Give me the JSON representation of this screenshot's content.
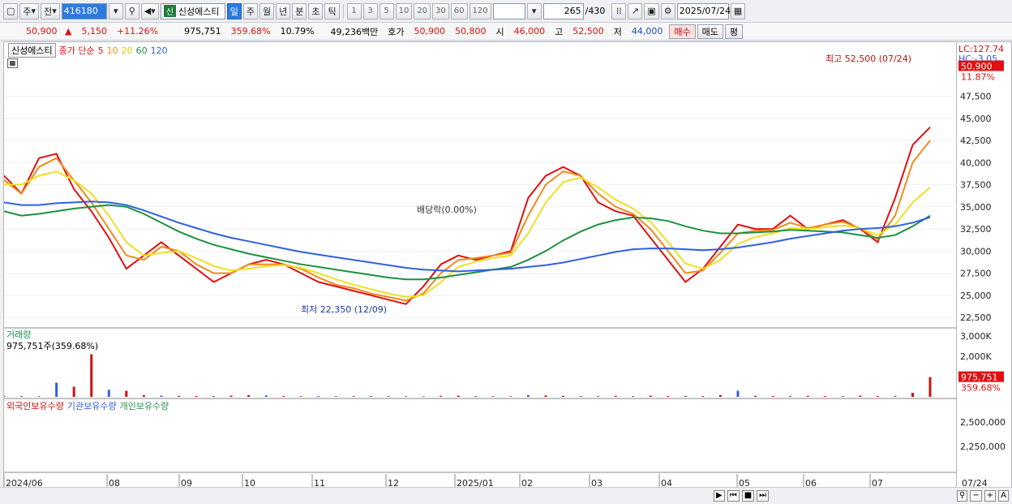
{
  "toolbar": {
    "type_selected": "주",
    "prev_label": "전",
    "code": "416180",
    "stock_name": "신성에스티",
    "shin_label": "신",
    "period_buttons": [
      "일",
      "주",
      "월",
      "년",
      "분",
      "초",
      "틱"
    ],
    "period_active": "일",
    "interval_buttons": [
      "1",
      "3",
      "5",
      "10",
      "20",
      "30",
      "60",
      "120"
    ],
    "count": "265",
    "count_total": "/430",
    "date": "2025/07/24"
  },
  "quote": {
    "price": "50,900",
    "change": "5,150",
    "change_pct": "+11.26%",
    "volume": "975,751",
    "vol_ratio": "359.68%",
    "turnover_pct": "10.79%",
    "amount": "49,236백만",
    "ask_label": "호가",
    "ask1": "50,900",
    "ask2": "50,800",
    "open_label": "시",
    "open": "46,000",
    "high_label": "고",
    "high": "52,500",
    "low_label": "저",
    "low": "44,000",
    "buy_btn": "매수",
    "sell_btn": "매도",
    "eval_btn": "평"
  },
  "price_panel": {
    "legend_name": "신성에스티",
    "legend_series": "종가 단순",
    "ma": [
      {
        "label": "5",
        "color": "#e01010"
      },
      {
        "label": "10",
        "color": "#f08a1c"
      },
      {
        "label": "20",
        "color": "#f0e020"
      },
      {
        "label": "60",
        "color": "#1e9040"
      },
      {
        "label": "120",
        "color": "#3060e0"
      }
    ],
    "lc": "LC:127.74",
    "hc": "HC:-3.05",
    "cur_price_tag": "50,900",
    "cur_pct_tag": "11.87%",
    "y_ticks": [
      "47,500",
      "45,000",
      "42,500",
      "40,000",
      "37,500",
      "35,000",
      "32,500",
      "30,000",
      "27,500",
      "25,000",
      "22,500"
    ],
    "ann_high": "최고 52,500 (07/24)",
    "ann_low": "최저 22,350 (12/09)",
    "ann_div": "배당락(0.00%)"
  },
  "volume_panel": {
    "title": "거래량",
    "sub": "975,751주(359.68%)",
    "y_ticks": [
      "3,000K",
      "2,000K",
      "1,000K"
    ],
    "tag_value": "975,751",
    "tag_pct": "359.68%"
  },
  "holdings_panel": {
    "series": [
      {
        "label": "외국인보유수량",
        "color": "#d01010"
      },
      {
        "label": "기관보유수량",
        "color": "#3060e0"
      },
      {
        "label": "개인보유수량",
        "color": "#2a9050"
      }
    ],
    "y_ticks": [
      "2,500,000",
      "2,250,000"
    ]
  },
  "x_axis": {
    "labels": [
      "2024/06",
      "08",
      "09",
      "10",
      "11",
      "12",
      "2025/01",
      "02",
      "03",
      "04",
      "05",
      "06",
      "07"
    ],
    "last_label": "07/24"
  },
  "chart_data": {
    "type": "line",
    "title": "",
    "ylim": [
      21500,
      52500
    ],
    "ma_series": [
      {
        "name": "5",
        "values": [
          38500,
          36500,
          40500,
          41000,
          37000,
          34500,
          31500,
          28000,
          29500,
          31000,
          29500,
          28000,
          26500,
          27500,
          28500,
          29000,
          28500,
          27500,
          26500,
          26000,
          25500,
          25000,
          24500,
          24000,
          26000,
          28500,
          29500,
          29000,
          29500,
          30000,
          36000,
          38500,
          39500,
          38500,
          35500,
          34500,
          34000,
          31500,
          29000,
          26500,
          28000,
          30500,
          33000,
          32500,
          32500,
          34000,
          32500,
          33000,
          33500,
          32500,
          31000,
          36000,
          42000,
          44000
        ]
      },
      {
        "name": "10",
        "values": [
          38000,
          36500,
          39500,
          40500,
          38000,
          35500,
          32500,
          29500,
          29000,
          30500,
          30000,
          28500,
          27500,
          27500,
          28500,
          28500,
          28500,
          28000,
          27000,
          26200,
          25800,
          25200,
          24800,
          24400,
          25200,
          27500,
          29000,
          29200,
          29500,
          29800,
          34000,
          37500,
          39000,
          38500,
          36500,
          35000,
          34200,
          32500,
          30000,
          27500,
          27800,
          29800,
          32000,
          32300,
          32400,
          33200,
          32600,
          33000,
          33300,
          32600,
          31300,
          34000,
          40000,
          42500
        ]
      },
      {
        "name": "20",
        "values": [
          37500,
          37500,
          38500,
          39000,
          38000,
          36500,
          34000,
          31000,
          29500,
          29800,
          30000,
          29200,
          28300,
          27800,
          28000,
          28300,
          28400,
          28100,
          27500,
          26800,
          26200,
          25700,
          25200,
          24800,
          25000,
          26500,
          28200,
          28800,
          29200,
          29500,
          32000,
          35500,
          37800,
          38300,
          37200,
          35800,
          34800,
          33300,
          31000,
          28600,
          28000,
          29000,
          30800,
          31600,
          32000,
          32600,
          32500,
          32700,
          32900,
          32600,
          31800,
          33000,
          35500,
          37200
        ]
      },
      {
        "name": "60",
        "values": [
          34500,
          34000,
          34200,
          34500,
          34800,
          35000,
          35200,
          35000,
          34200,
          33200,
          32200,
          31400,
          30700,
          30200,
          29700,
          29300,
          28900,
          28500,
          28200,
          27900,
          27600,
          27300,
          27000,
          26800,
          26800,
          27000,
          27300,
          27600,
          27900,
          28200,
          29000,
          30000,
          31200,
          32200,
          33000,
          33500,
          33800,
          33700,
          33400,
          32800,
          32300,
          32000,
          32000,
          32100,
          32200,
          32400,
          32300,
          32200,
          32100,
          31800,
          31500,
          31800,
          32800,
          34000
        ]
      },
      {
        "name": "120",
        "values": [
          35500,
          35200,
          35200,
          35400,
          35500,
          35600,
          35500,
          35200,
          34600,
          33900,
          33200,
          32600,
          32000,
          31500,
          31100,
          30700,
          30300,
          29900,
          29600,
          29300,
          29000,
          28700,
          28400,
          28100,
          27900,
          27800,
          27700,
          27800,
          27900,
          28000,
          28200,
          28400,
          28700,
          29100,
          29500,
          29900,
          30200,
          30300,
          30300,
          30200,
          30100,
          30200,
          30400,
          30700,
          31000,
          31400,
          31700,
          32000,
          32300,
          32500,
          32600,
          32800,
          33200,
          33800
        ]
      }
    ],
    "volume_values": [
      40,
      30,
      30,
      700,
      500,
      2100,
      350,
      300,
      80,
      60,
      50,
      40,
      40,
      60,
      80,
      70,
      40,
      30,
      40,
      30,
      30,
      40,
      30,
      30,
      30,
      50,
      60,
      40,
      30,
      30,
      80,
      70,
      50,
      40,
      30,
      50,
      40,
      60,
      40,
      50,
      40,
      90,
      300,
      50,
      40,
      40,
      50,
      40,
      40,
      60,
      40,
      50,
      200,
      975
    ]
  }
}
